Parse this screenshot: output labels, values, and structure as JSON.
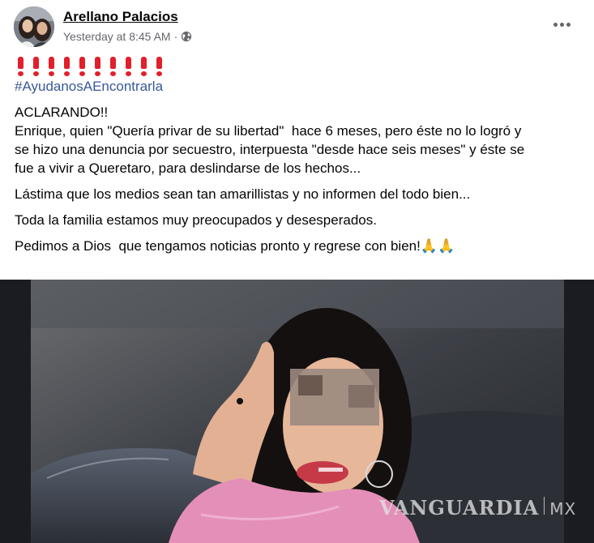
{
  "post": {
    "author": "Arellano Palacios",
    "timestamp": "Yesterday at 8:45 AM",
    "separator": "·",
    "audience_icon": "globe-icon",
    "exclamation_count": 10,
    "hashtag": "#AyudanosAEncontrarla",
    "paragraphs": [
      {
        "lines": [
          "ACLARANDO!!",
          "Enrique, quien \"Quería privar de su libertad\"  hace 6 meses, pero éste no lo logró y",
          "se hizo una denuncia por secuestro, interpuesta \"desde hace seis meses\" y éste se",
          "fue a vivir a Queretaro, para deslindarse de los hechos..."
        ]
      },
      {
        "lines": [
          "Lástima que los medios sean tan amarillistas y no informen del todo bien..."
        ]
      },
      {
        "lines": [
          "Toda la familia estamos muy preocupados y desesperados."
        ]
      },
      {
        "lines": [
          "Pedimos a Dios  que tengamos noticias pronto y regrese con bien!🙏🙏"
        ]
      }
    ]
  },
  "photo": {
    "watermark_brand": "VANGUARDIA",
    "watermark_suffix": "MX"
  },
  "colors": {
    "author": "#050505",
    "meta": "#65676b",
    "hashtag": "#385898",
    "exclamation": "#e0202a"
  }
}
